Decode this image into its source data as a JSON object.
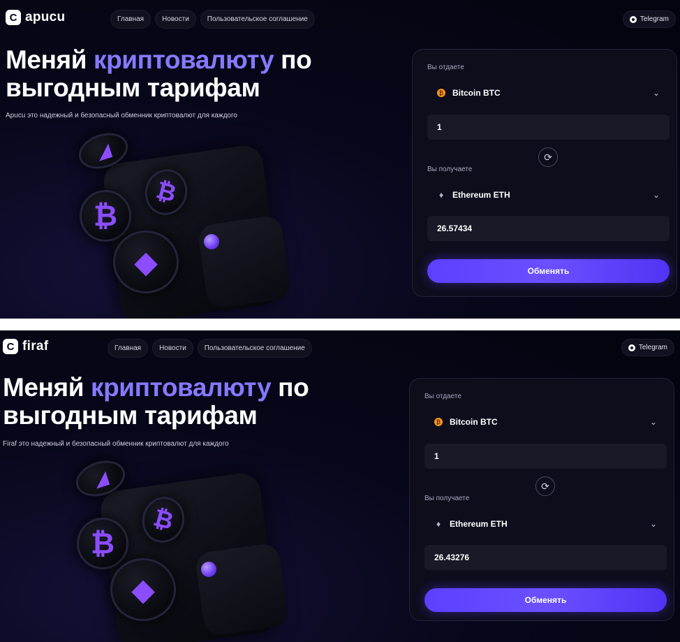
{
  "panel_a": {
    "brand": {
      "mark": "C",
      "name": "apucu"
    },
    "nav": [
      "Главная",
      "Новости",
      "Пользовательское соглашение"
    ],
    "telegram_label": "Telegram",
    "hero": {
      "title_pre": "Меняй ",
      "title_accent": "криптовалюту",
      "title_post": " по выгодным тарифам",
      "subtitle": "Apucu это надежный и безопасный обменник криптовалют для каждого"
    },
    "exchange": {
      "give_label": "Вы отдаете",
      "give_currency": "Bitcoin BTC",
      "give_amount": "1",
      "receive_label": "Вы получаете",
      "receive_currency": "Ethereum ETH",
      "receive_amount": "26.57434",
      "submit_label": "Обменять"
    }
  },
  "panel_b": {
    "brand": {
      "mark": "C",
      "name": "firaf"
    },
    "nav": [
      "Главная",
      "Новости",
      "Пользовательское соглашение"
    ],
    "telegram_label": "Telegram",
    "hero": {
      "title_pre": "Меняй ",
      "title_accent": "криптовалюту",
      "title_post": " по выгодным тарифам",
      "subtitle": "Firaf это надежный и безопасный обменник криптовалют для каждого"
    },
    "exchange": {
      "give_label": "Вы отдаете",
      "give_currency": "Bitcoin BTC",
      "give_amount": "1",
      "receive_label": "Вы получаете",
      "receive_currency": "Ethereum ETH",
      "receive_amount": "26.43276",
      "submit_label": "Обменять"
    }
  },
  "icons": {
    "btc_glyph": "₿",
    "eth_glyph": "◆",
    "small_coin_glyph": "◢",
    "chevron": "⌄",
    "swap": "⟳"
  },
  "colors": {
    "background": "#07071a",
    "accent_text": "#8679ff",
    "button": "#5b40ff",
    "coin_purple": "#8b4dff",
    "btc_orange": "#f7931a"
  }
}
